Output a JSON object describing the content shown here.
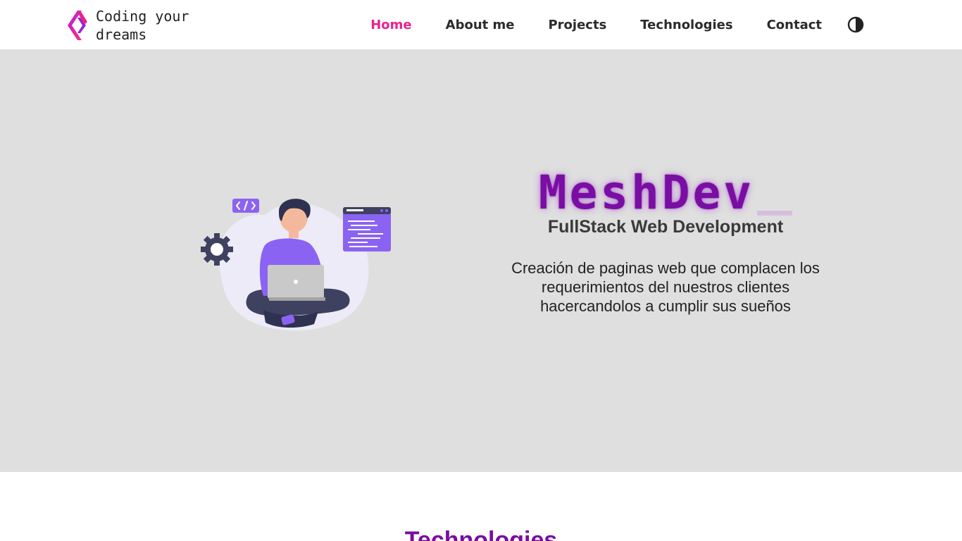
{
  "header": {
    "brand_text": "Coding your dreams",
    "logo_icon": "hexagon-arrow-logo-icon",
    "nav": [
      {
        "label": "Home",
        "active": true
      },
      {
        "label": "About me",
        "active": false
      },
      {
        "label": "Projects",
        "active": false
      },
      {
        "label": "Technologies",
        "active": false
      },
      {
        "label": "Contact",
        "active": false
      }
    ],
    "theme_toggle_icon": "contrast-icon"
  },
  "hero": {
    "title": "MeshDev",
    "subtitle": "FullStack Web Development",
    "description": "Creación de paginas web que complacen los requerimientos del nuestros clientes hacercandolos a cumplir sus sueños",
    "illustration": "developer-with-laptop-illustration"
  },
  "sections": {
    "technologies_title": "Technologies"
  },
  "colors": {
    "accent_pink": "#e8228e",
    "brand_purple": "#7a0da3",
    "hero_background": "#dfdfdf"
  }
}
